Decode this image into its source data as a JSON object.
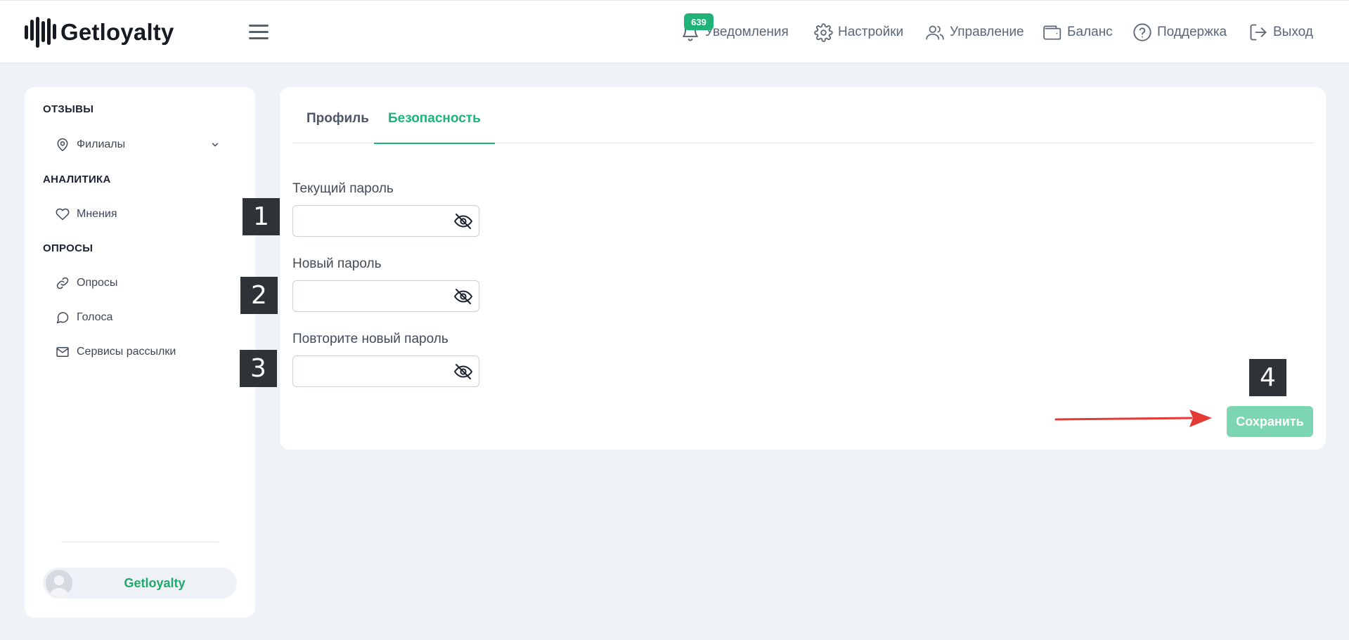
{
  "header": {
    "logo_text": "Getloyalty",
    "notification_count": "639",
    "nav": [
      {
        "label": "Уведомления",
        "icon": "bell-icon"
      },
      {
        "label": "Настройки",
        "icon": "gear-icon"
      },
      {
        "label": "Управление",
        "icon": "users-icon"
      },
      {
        "label": "Баланс",
        "icon": "wallet-icon"
      },
      {
        "label": "Поддержка",
        "icon": "help-circle-icon"
      },
      {
        "label": "Выход",
        "icon": "logout-icon"
      }
    ]
  },
  "sidebar": {
    "sections": [
      {
        "title": "ОТЗЫВЫ",
        "items": [
          {
            "label": "Филиалы",
            "icon": "map-pin-icon",
            "has_dropdown": true
          }
        ]
      },
      {
        "title": "АНАЛИТИКА",
        "items": [
          {
            "label": "Мнения",
            "icon": "heart-icon"
          }
        ]
      },
      {
        "title": "ОПРОСЫ",
        "items": [
          {
            "label": "Опросы",
            "icon": "link-icon"
          },
          {
            "label": "Голоса",
            "icon": "chat-bubble-icon"
          },
          {
            "label": "Сервисы рассылки",
            "icon": "mail-icon"
          }
        ]
      }
    ],
    "user": {
      "name": "Getloyalty"
    }
  },
  "main": {
    "tabs": [
      {
        "label": "Профиль",
        "active": false
      },
      {
        "label": "Безопасность",
        "active": true
      }
    ],
    "fields": [
      {
        "label": "Текущий пароль",
        "value": ""
      },
      {
        "label": "Новый пароль",
        "value": ""
      },
      {
        "label": "Повторите новый пароль",
        "value": ""
      }
    ],
    "save_label": "Сохранить"
  },
  "annotations": {
    "markers": [
      "1",
      "2",
      "3",
      "4"
    ]
  },
  "colors": {
    "accent": "#1fb37a",
    "save_button": "#7dd6b3",
    "marker_bg": "#2f3236",
    "arrow": "#e53935",
    "page_bg": "#eff2f7"
  }
}
